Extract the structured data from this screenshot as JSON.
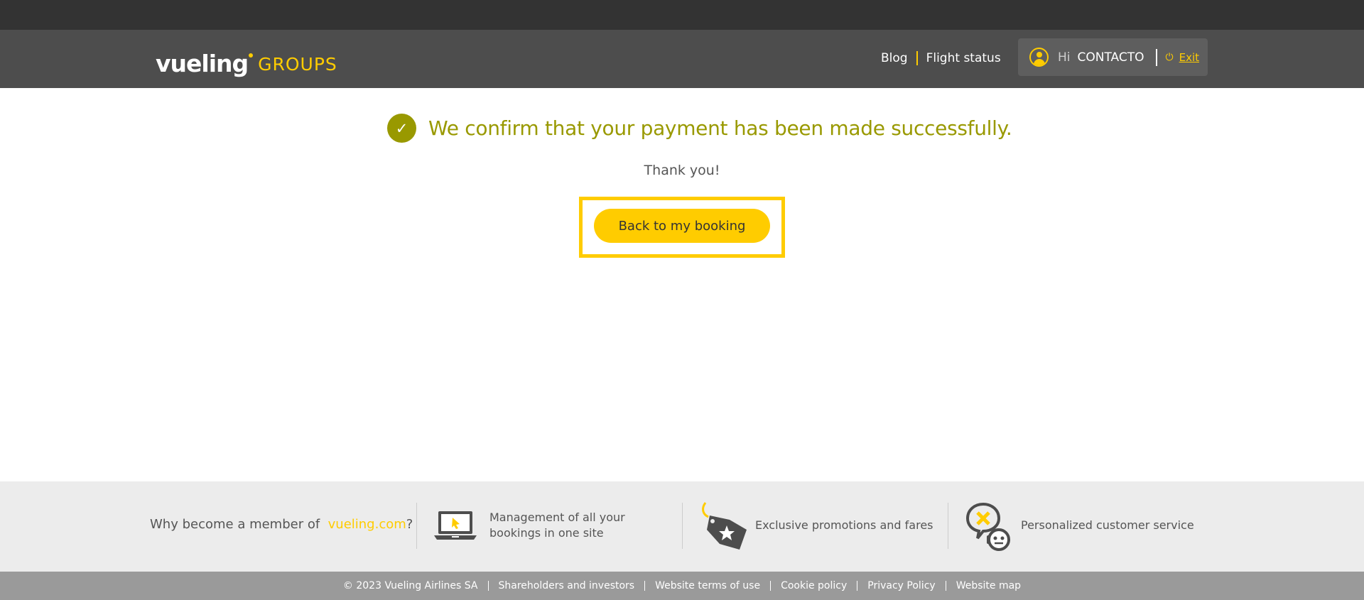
{
  "header": {
    "logo_main": "vueling",
    "logo_sub": "GROUPS",
    "nav": [
      "Blog",
      "Flight status"
    ],
    "user": {
      "greeting": "Hi",
      "name": "CONTACTO",
      "exit_label": "Exit"
    }
  },
  "main": {
    "confirmation": "We confirm that your payment has been made successfully.",
    "thanks": "Thank you!",
    "back_button": "Back to my booking"
  },
  "benefits": {
    "why_prefix": "Why become a member of",
    "why_brand": "vueling.com",
    "why_suffix": "?",
    "items": [
      {
        "icon": "laptop-icon",
        "text": "Management of all your bookings in one site"
      },
      {
        "icon": "tag-star-icon",
        "text": "Exclusive promotions and fares"
      },
      {
        "icon": "customer-service-icon",
        "text": "Personalized customer service"
      }
    ]
  },
  "footer": {
    "links": [
      "© 2023 Vueling Airlines SA",
      "Shareholders and investors",
      "Website terms of use",
      "Cookie policy",
      "Privacy Policy",
      "Website map"
    ]
  },
  "colors": {
    "brand_yellow": "#ffcc00",
    "success_olive": "#999900",
    "header_gray": "#4d4d4d"
  }
}
